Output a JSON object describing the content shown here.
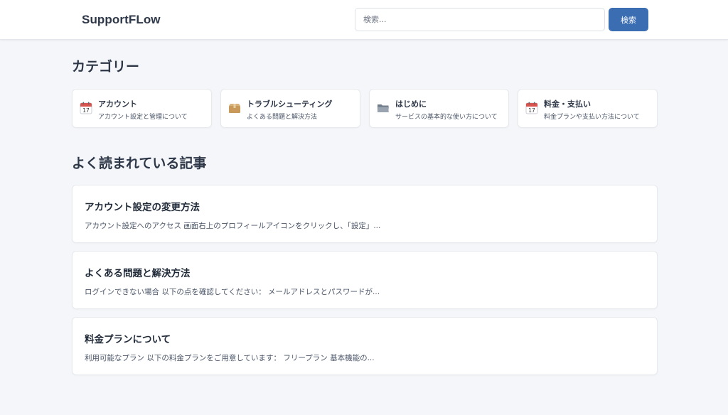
{
  "header": {
    "logo": "SupportFLow",
    "search_placeholder": "検索...",
    "search_button": "検索"
  },
  "categories_section": {
    "title": "カテゴリー",
    "items": [
      {
        "icon": "calendar-icon",
        "title": "アカウント",
        "description": "アカウント設定と管理について"
      },
      {
        "icon": "package-icon",
        "title": "トラブルシューティング",
        "description": "よくある問題と解決方法"
      },
      {
        "icon": "folder-icon",
        "title": "はじめに",
        "description": "サービスの基本的な使い方について"
      },
      {
        "icon": "calendar-icon",
        "title": "料金・支払い",
        "description": "料金プランや支払い方法について"
      }
    ]
  },
  "popular_section": {
    "title": "よく読まれている記事",
    "articles": [
      {
        "title": "アカウント設定の変更方法",
        "excerpt": "アカウント設定へのアクセス 画面右上のプロフィールアイコンをクリックし、「設定」..."
      },
      {
        "title": "よくある問題と解決方法",
        "excerpt": "ログインできない場合 以下の点を確認してください： メールアドレスとパスワードが..."
      },
      {
        "title": "料金プランについて",
        "excerpt": "利用可能なプラン 以下の料金プランをご用意しています： フリープラン 基本機能の..."
      }
    ]
  },
  "colors": {
    "accent": "#3b6db3",
    "background": "#f4f6f9",
    "card": "#ffffff",
    "text": "#2d3748"
  }
}
